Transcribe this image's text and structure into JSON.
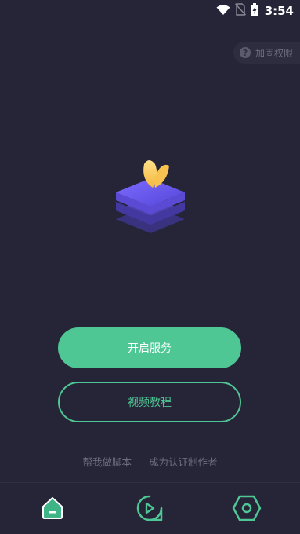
{
  "status_bar": {
    "time": "3:54",
    "icons": [
      "wifi-icon",
      "no-sim-icon",
      "battery-charging-icon"
    ]
  },
  "permission_button": {
    "icon": "question-icon",
    "label": "加固权限"
  },
  "logo": {
    "name": "app-logo-stacked-layers-leaf",
    "colors": [
      "#6a5cf0",
      "#4b3fc2",
      "#ffd166"
    ]
  },
  "buttons": {
    "start_service": "开启服务",
    "video_tutorial": "视频教程"
  },
  "links": {
    "help_script": "帮我做脚本",
    "become_author": "成为认证制作者"
  },
  "bottom_nav": {
    "items": [
      {
        "icon": "home-icon",
        "active": true
      },
      {
        "icon": "play-search-icon",
        "active": false
      },
      {
        "icon": "settings-hexagon-icon",
        "active": false
      }
    ]
  },
  "colors": {
    "background": "#262538",
    "accent": "#4fc795",
    "muted_text": "#6e6d7e"
  }
}
